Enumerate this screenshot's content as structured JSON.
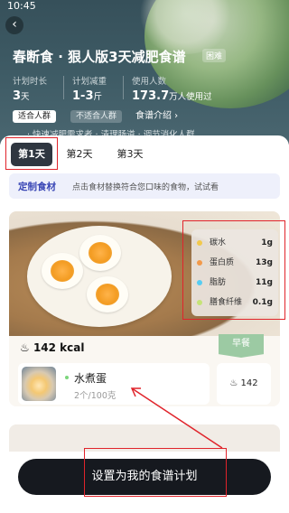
{
  "status_bar": {
    "time": "10:45"
  },
  "header": {
    "back_glyph": "‹",
    "title": "春断食 · 狠人版3天减肥食谱",
    "difficulty": "困难",
    "stats": [
      {
        "label": "计划时长",
        "value": "3",
        "unit": "天"
      },
      {
        "label": "计划减重",
        "value": "1-3",
        "unit": "斤"
      },
      {
        "label": "使用人数",
        "value": "173.7",
        "unit": "万人使用过"
      }
    ],
    "chips": {
      "suitable": "适合人群",
      "unsuitable": "不适合人群",
      "intro": "食谱介绍 ›"
    },
    "notice": "· 快速减肥需求者 · 清理肠道 · 调节消化人群"
  },
  "day_tabs": [
    "第1天",
    "第2天",
    "第3天"
  ],
  "custom_bar": {
    "title": "定制食材",
    "desc": "点击食材替换符合您口味的食物，试试看"
  },
  "food_card": {
    "nutrition": [
      {
        "name": "碳水",
        "value": "1g",
        "color": "#f2c94c"
      },
      {
        "name": "蛋白质",
        "value": "13g",
        "color": "#f2994a"
      },
      {
        "name": "脂肪",
        "value": "11g",
        "color": "#56ccf2"
      },
      {
        "name": "膳食纤维",
        "value": "0.1g",
        "color": "#c6e377"
      }
    ],
    "kcal": "142 kcal",
    "meal_tag": "早餐",
    "item": {
      "name": "水煮蛋",
      "qty": "2个/100克",
      "kcal": "142"
    }
  },
  "cta": "设置为我的食谱计划",
  "colors": {
    "highlight": "#e0242b",
    "dark": "#16191f",
    "accent": "#3946b5"
  }
}
